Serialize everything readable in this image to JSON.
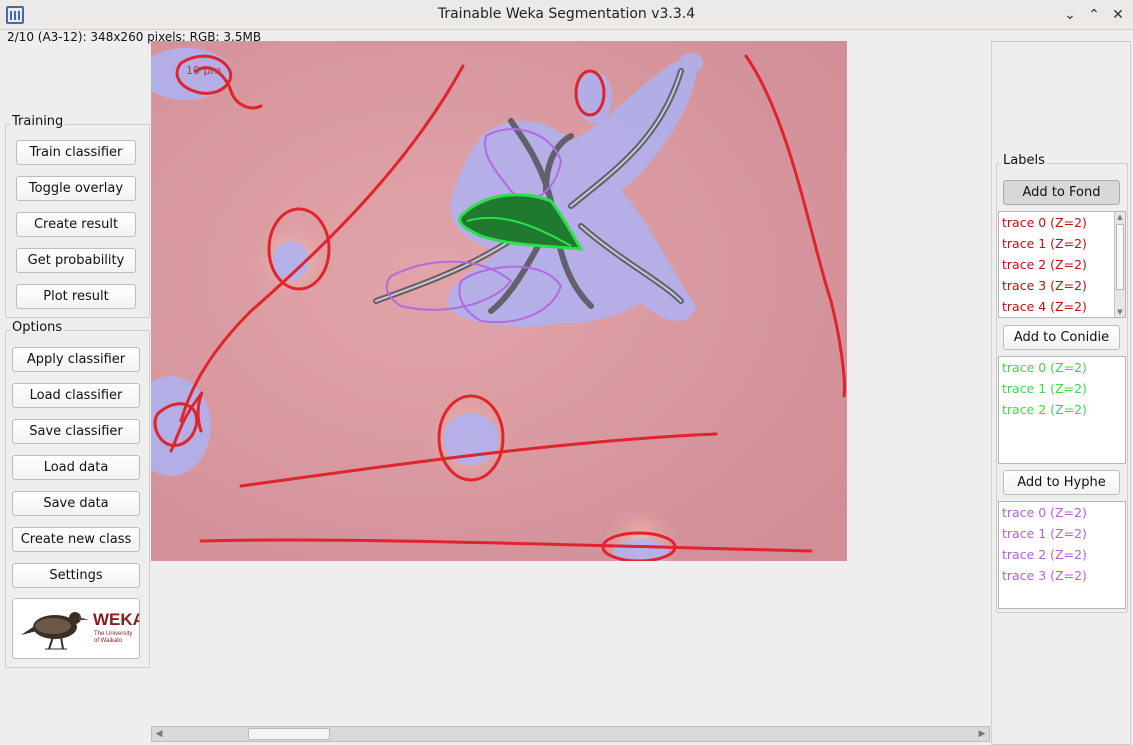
{
  "window": {
    "title": "Trainable Weka Segmentation v3.3.4",
    "icons": [
      "app-icon",
      "minimize-icon",
      "maximize-icon",
      "close-icon"
    ]
  },
  "status_text": "2/10 (A3-12): 348x260 pixels; RGB; 3.5MB",
  "training": {
    "label": "Training",
    "buttons": [
      "Train classifier",
      "Toggle overlay",
      "Create result",
      "Get probability",
      "Plot result"
    ]
  },
  "options": {
    "label": "Options",
    "buttons": [
      "Apply classifier",
      "Load classifier",
      "Save classifier",
      "Load data",
      "Save data",
      "Create new class",
      "Settings"
    ]
  },
  "logo": {
    "name": "WEKA",
    "sub1": "The University",
    "sub2": "of Waikato"
  },
  "image": {
    "scale_label": "10 µm"
  },
  "labels": {
    "label": "Labels",
    "classes": [
      {
        "button": "Add to Fond",
        "color": "#c01010",
        "traces": [
          "trace 0 (Z=2)",
          "trace 1 (Z=2)",
          "trace 2 (Z=2)",
          "trace 3 (Z=2)",
          "trace 4 (Z=2)"
        ]
      },
      {
        "button": "Add to Conidie",
        "color": "#3ed84b",
        "traces": [
          "trace 0 (Z=2)",
          "trace 1 (Z=2)",
          "trace 2 (Z=2)"
        ]
      },
      {
        "button": "Add to Hyphe",
        "color": "#b660e0",
        "traces": [
          "trace 0 (Z=2)",
          "trace 1 (Z=2)",
          "trace 2 (Z=2)",
          "trace 3 (Z=2)"
        ]
      }
    ]
  }
}
